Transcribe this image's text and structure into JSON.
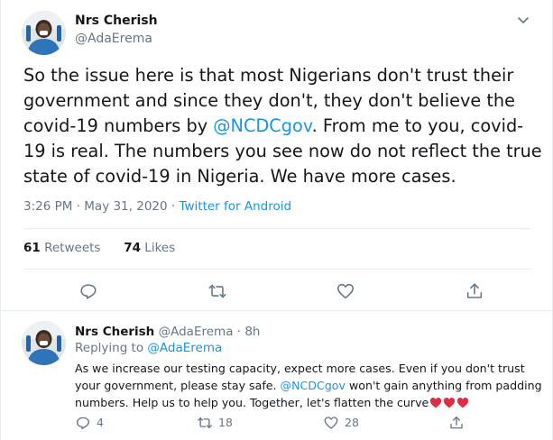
{
  "main_tweet": {
    "display_name": "Nrs Cherish",
    "handle": "@AdaErema",
    "text_before": "So the issue here is that most Nigerians don't trust their government and since they don't, they don't believe the covid-19 numbers by ",
    "mention": "@NCDCgov",
    "text_after": ". From me to you, covid-19 is real. The numbers you see now do not reflect the true state of covid-19 in Nigeria. We have more cases.",
    "timestamp": "3:26 PM · May 31, 2020 · ",
    "source": "Twitter for Android",
    "retweets_count": "61",
    "retweets_label": "Retweets",
    "likes_count": "74",
    "likes_label": "Likes"
  },
  "reply_tweet": {
    "display_name": "Nrs Cherish",
    "handle_time": "@AdaErema · 8h",
    "replying_prefix": "Replying to ",
    "replying_handle": "@AdaErema",
    "text_before": "As we increase our testing capacity, expect more cases. Even if you don't trust your government, please stay safe. ",
    "mention": "@NCDCgov",
    "text_after": " won't gain anything from padding numbers. Help us to help you. Together, let's flatten the curve",
    "replies_count": "4",
    "retweets_count": "18",
    "likes_count": "28"
  },
  "colors": {
    "accent": "#1b95e0",
    "muted": "#657786",
    "text": "#14171a",
    "divider": "#e6ecf0",
    "heart": "#e0245e"
  },
  "icons": {
    "chevron": "chevron-down-icon",
    "reply": "reply-icon",
    "retweet": "retweet-icon",
    "like": "heart-outline-icon",
    "share": "share-icon",
    "emoji": "red-heart-emoji"
  }
}
